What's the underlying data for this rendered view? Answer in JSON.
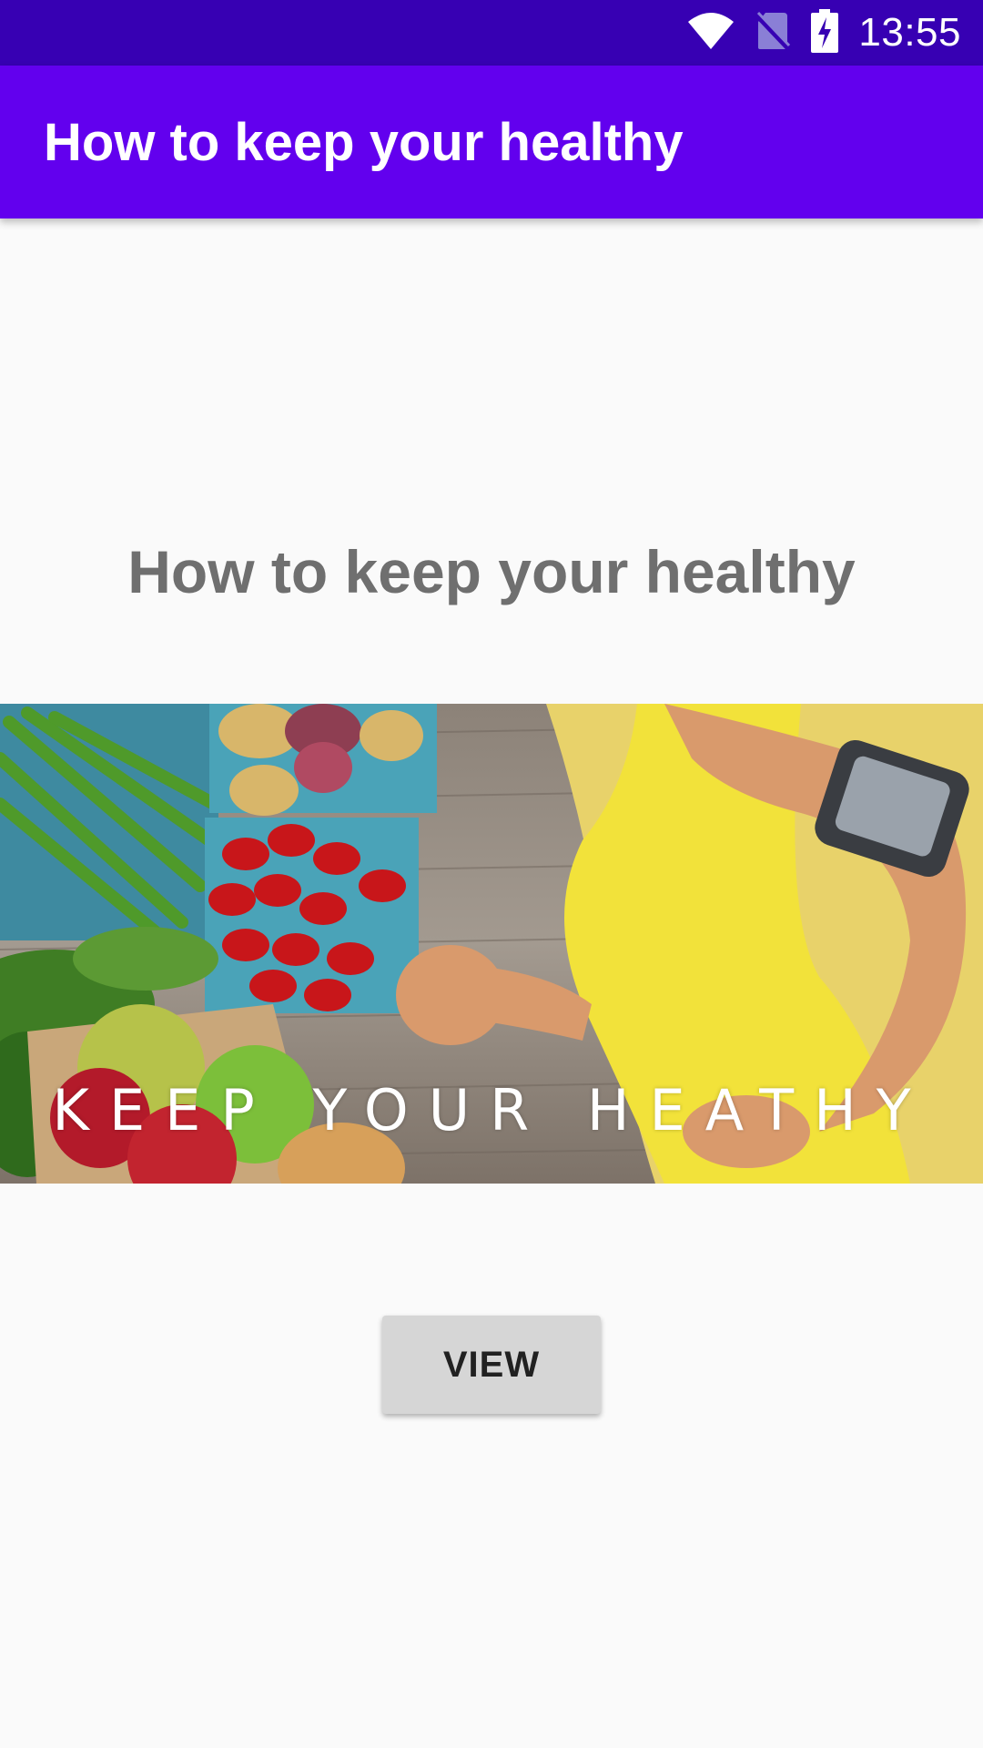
{
  "status_bar": {
    "time": "13:55",
    "icons": [
      "wifi-icon",
      "no-sim-icon",
      "battery-charging-icon"
    ],
    "color": "#3700b3"
  },
  "app_bar": {
    "title": "How to keep your healthy",
    "color": "#6200ee"
  },
  "main": {
    "heading": "How to keep your healthy",
    "hero_image_text": "KEEP YOUR HEATHY",
    "view_button_label": "VIEW"
  }
}
